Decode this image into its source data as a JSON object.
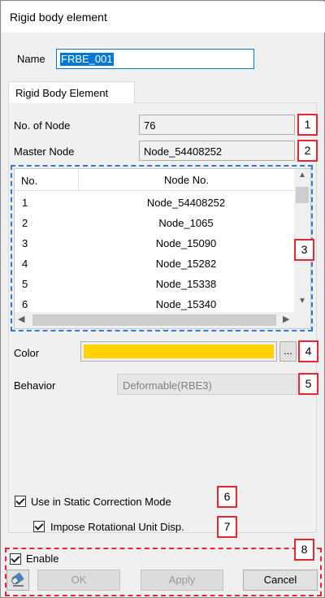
{
  "window": {
    "title": "Rigid body element"
  },
  "name": {
    "label": "Name",
    "value": "FRBE_001"
  },
  "tab": {
    "label": "Rigid Body Element"
  },
  "node_count": {
    "label": "No. of Node",
    "value": "76"
  },
  "master_node": {
    "label": "Master Node",
    "value": "Node_54408252"
  },
  "table": {
    "columns": [
      "No.",
      "Node No."
    ],
    "rows": [
      [
        "1",
        "Node_54408252"
      ],
      [
        "2",
        "Node_1065"
      ],
      [
        "3",
        "Node_15090"
      ],
      [
        "4",
        "Node_15282"
      ],
      [
        "5",
        "Node_15338"
      ],
      [
        "6",
        "Node_15340"
      ]
    ]
  },
  "color": {
    "label": "Color",
    "value_hex": "#ffd200",
    "button_label": "..."
  },
  "behavior": {
    "label": "Behavior",
    "value": "Deformable(RBE3)"
  },
  "options": {
    "static_correction": "Use in Static Correction Mode",
    "impose_rotational": "Impose Rotational Unit Disp."
  },
  "footer": {
    "enable_label": "Enable",
    "ok_label": "OK",
    "apply_label": "Apply",
    "cancel_label": "Cancel"
  },
  "markers": [
    "1",
    "2",
    "3",
    "4",
    "5",
    "6",
    "7",
    "8"
  ],
  "colors": {
    "marker": "#e8262d",
    "table_outline": "#2e7bd6",
    "selection": "#0078d7"
  }
}
